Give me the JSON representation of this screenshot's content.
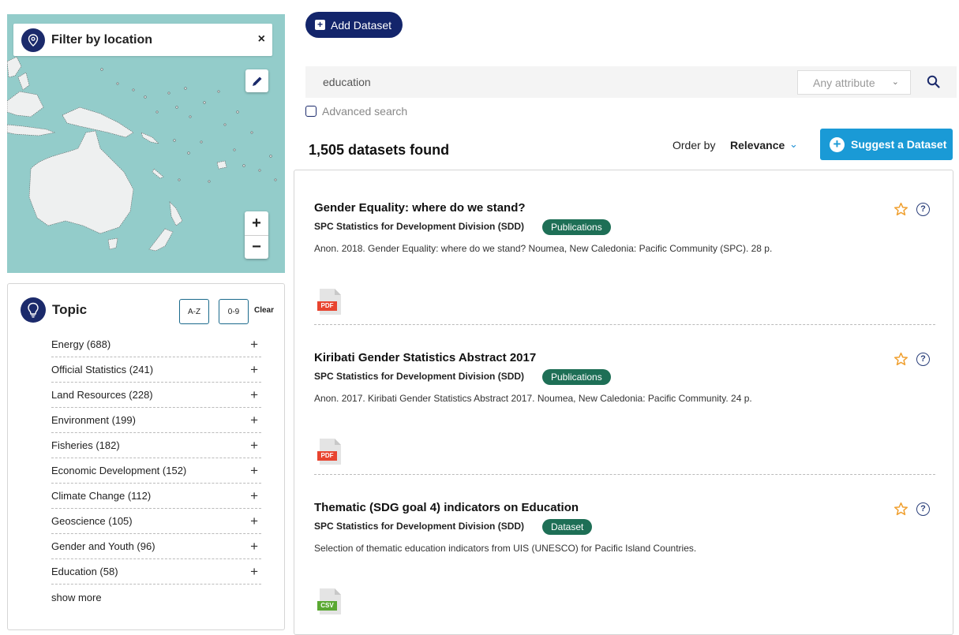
{
  "map": {
    "title": "Filter by location",
    "close_label": "×",
    "zoom_in_label": "+",
    "zoom_out_label": "−",
    "colors": {
      "water": "#93ccca",
      "land": "#eef0f0",
      "badge": "#1b2a6b"
    }
  },
  "topic_panel": {
    "title": "Topic",
    "sort_az_label": "A-Z",
    "sort_09_label": "0-9",
    "clear_label": "Clear",
    "items": [
      {
        "label": "Energy (688)"
      },
      {
        "label": "Official Statistics (241)"
      },
      {
        "label": "Land Resources (228)"
      },
      {
        "label": "Environment (199)"
      },
      {
        "label": "Fisheries (182)"
      },
      {
        "label": "Economic Development (152)"
      },
      {
        "label": "Climate Change (112)"
      },
      {
        "label": "Geoscience (105)"
      },
      {
        "label": "Gender and Youth (96)"
      },
      {
        "label": "Education (58)"
      }
    ],
    "expand_icon_label": "+",
    "show_more_label": "show more"
  },
  "toolbar": {
    "add_dataset_label": "Add Dataset",
    "add_dataset_color": "#13256b"
  },
  "search": {
    "value": "education",
    "attribute_select_value": "Any attribute",
    "advanced_label": "Advanced search"
  },
  "results_header": {
    "count_label": "1,505 datasets found",
    "order_label": "Order by",
    "order_value": "Relevance",
    "suggest_label": "Suggest a Dataset",
    "suggest_color": "#1a9ad6"
  },
  "results": [
    {
      "title": "Gender Equality: where do we stand?",
      "org": "SPC Statistics for Development Division (SDD)",
      "badge": "Publications",
      "description": "Anon. 2018. Gender Equality: where do we stand? Noumea, New Caledonia: Pacific Community (SPC). 28 p.",
      "file_type": "PDF"
    },
    {
      "title": "Kiribati Gender Statistics Abstract 2017",
      "org": "SPC Statistics for Development Division (SDD)",
      "badge": "Publications",
      "description": "Anon. 2017. Kiribati Gender Statistics Abstract 2017. Noumea, New Caledonia: Pacific Community. 24 p.",
      "file_type": "PDF"
    },
    {
      "title": "Thematic (SDG goal 4) indicators on Education",
      "org": "SPC Statistics for Development Division (SDD)",
      "badge": "Dataset",
      "description": "Selection of thematic education indicators from UIS (UNESCO) for Pacific Island Countries.",
      "file_type": "CSV"
    }
  ],
  "icons": {
    "help_glyph": "?",
    "badge_color": "#1e6f56",
    "star_color": "#f0a030"
  }
}
